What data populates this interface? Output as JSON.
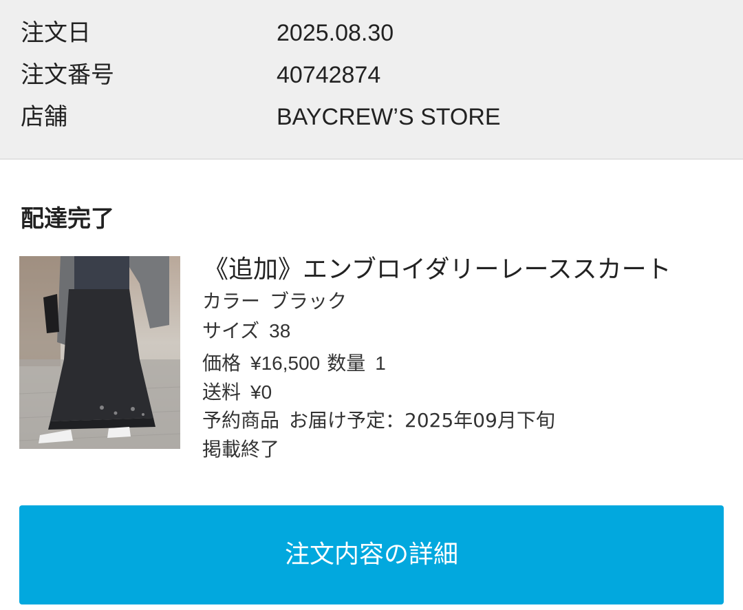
{
  "order_summary": {
    "rows": [
      {
        "label": "注文日",
        "value": "2025.08.30"
      },
      {
        "label": "注文番号",
        "value": "40742874"
      },
      {
        "label": "店舗",
        "value": "BAYCREW’S STORE"
      }
    ]
  },
  "shipment": {
    "status": "配達完了"
  },
  "product": {
    "image_icon": "product-photo-icon",
    "name": "《追加》エンブロイダリーレーススカート",
    "color_label": "カラー",
    "color_value": "ブラック",
    "size_label": "サイズ",
    "size_value": "38",
    "price_label": "価格",
    "price_value": "¥16,500",
    "quantity_label": "数量",
    "quantity_value": "1",
    "shipping_label": "送料",
    "shipping_value": "¥0",
    "reservation_label": "予約商品",
    "delivery_text": "お届け予定：2025年09月下旬",
    "listing_status": "掲載終了"
  },
  "actions": {
    "detail_button_label": "注文内容の詳細"
  },
  "colors": {
    "summary_background": "#efefef",
    "button_background": "#02a8de",
    "button_text": "#ffffff"
  }
}
